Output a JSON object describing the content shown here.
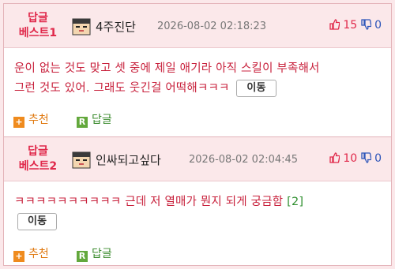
{
  "comments": [
    {
      "badge_line1": "답글",
      "badge_line2": "베스트1",
      "nickname": "4주진단",
      "datetime": "2026-08-02 02:18:23",
      "upvotes": "15",
      "downvotes": "0",
      "text_line1": "운이 없는 것도 맞고 셋 중에 제일 애기라 아직 스킬이 부족해서",
      "text_line2": "그런 것도 있어. 그래도 웃긴걸 어떡해ㅋㅋㅋ",
      "move_label": "이동",
      "recommend_label": "추천",
      "reply_label": "답글",
      "recommend_icon": "+",
      "reply_icon": "R"
    },
    {
      "badge_line1": "답글",
      "badge_line2": "베스트2",
      "nickname": "인싸되고싶다",
      "datetime": "2026-08-02 02:04:45",
      "upvotes": "10",
      "downvotes": "0",
      "text_line1": "ㅋㅋㅋㅋㅋㅋㅋㅋㅋㅋ 근데 저 열매가 뭔지 되게 궁금함",
      "reply_count": "[2]",
      "move_label": "이동",
      "recommend_label": "추천",
      "reply_label": "답글",
      "recommend_icon": "+",
      "reply_icon": "R"
    }
  ],
  "colors": {
    "accent_red": "#e0284a",
    "body_text": "#c8213c",
    "down_blue": "#2c54b9",
    "recommend_orange": "#ef8b1e",
    "reply_green": "#63a83c",
    "header_bg": "#fbe8ea"
  }
}
